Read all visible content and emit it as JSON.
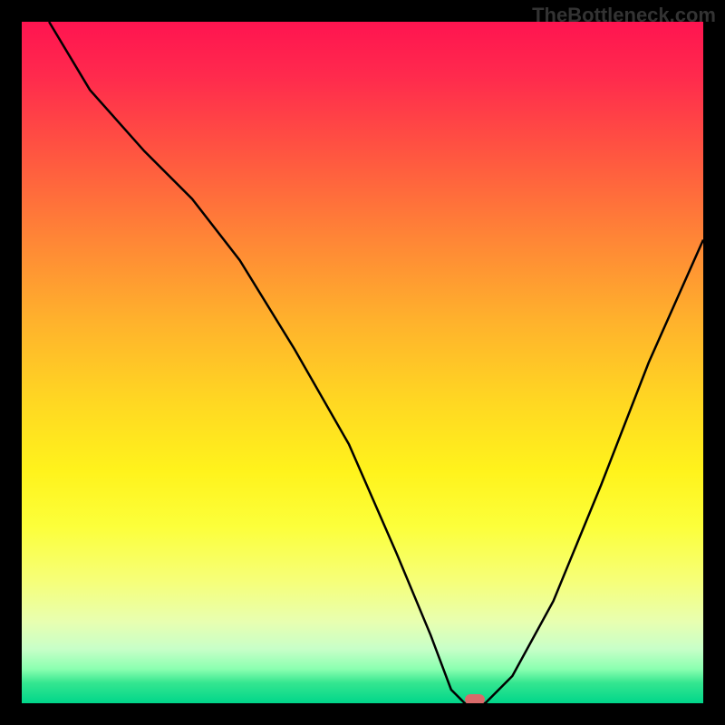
{
  "watermark": "TheBottleneck.com",
  "chart_data": {
    "type": "line",
    "title": "",
    "xlabel": "",
    "ylabel": "",
    "x_range": [
      0,
      100
    ],
    "y_range": [
      0,
      100
    ],
    "series": [
      {
        "name": "bottleneck-curve",
        "x": [
          4,
          10,
          18,
          25,
          32,
          40,
          48,
          55,
          60,
          63,
          65,
          68,
          72,
          78,
          85,
          92,
          100
        ],
        "values": [
          100,
          90,
          81,
          74,
          65,
          52,
          38,
          22,
          10,
          2,
          0,
          0,
          4,
          15,
          32,
          50,
          68
        ]
      }
    ],
    "marker": {
      "x": 66.5,
      "y": 0
    },
    "gradient_stops": [
      {
        "pos": 0,
        "color": "#ff1450"
      },
      {
        "pos": 50,
        "color": "#ffd822"
      },
      {
        "pos": 100,
        "color": "#00d68a"
      }
    ]
  }
}
